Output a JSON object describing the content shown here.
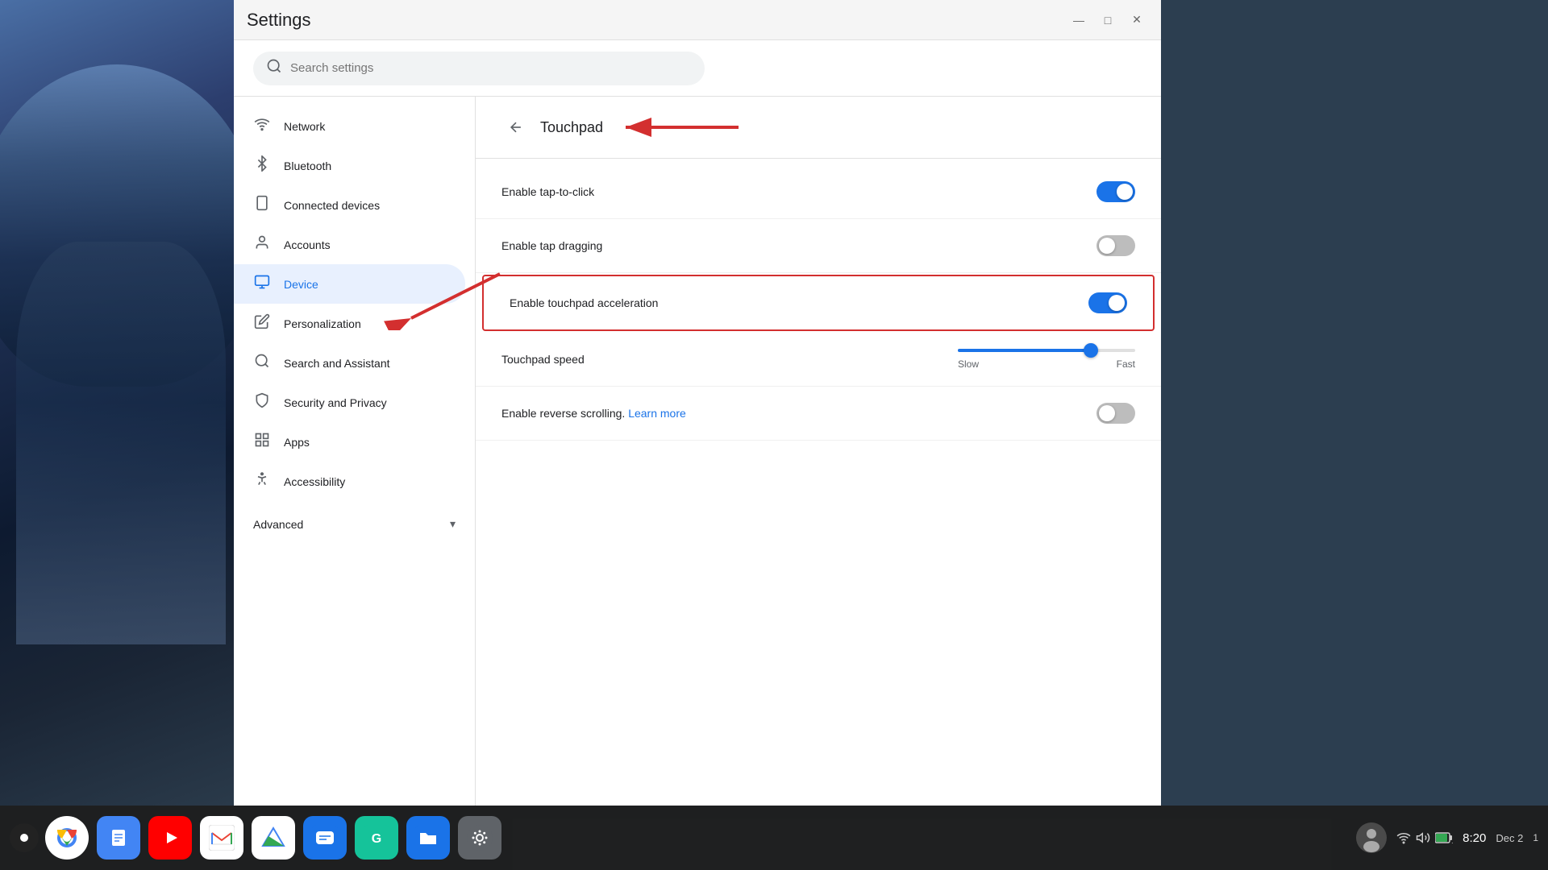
{
  "window": {
    "title": "Settings",
    "controls": {
      "minimize": "—",
      "maximize": "□",
      "close": "✕"
    }
  },
  "header": {
    "title": "Settings",
    "search_placeholder": "Search settings"
  },
  "sidebar": {
    "items": [
      {
        "id": "network",
        "label": "Network",
        "icon": "wifi"
      },
      {
        "id": "bluetooth",
        "label": "Bluetooth",
        "icon": "bluetooth"
      },
      {
        "id": "connected-devices",
        "label": "Connected devices",
        "icon": "smartphone"
      },
      {
        "id": "accounts",
        "label": "Accounts",
        "icon": "person"
      },
      {
        "id": "device",
        "label": "Device",
        "icon": "laptop",
        "active": true
      },
      {
        "id": "personalization",
        "label": "Personalization",
        "icon": "edit"
      },
      {
        "id": "search-assistant",
        "label": "Search and Assistant",
        "icon": "search"
      },
      {
        "id": "security-privacy",
        "label": "Security and Privacy",
        "icon": "shield"
      },
      {
        "id": "apps",
        "label": "Apps",
        "icon": "grid"
      },
      {
        "id": "accessibility",
        "label": "Accessibility",
        "icon": "accessibility"
      }
    ],
    "advanced": {
      "label": "Advanced",
      "icon": "chevron-down"
    }
  },
  "content": {
    "back_button": "←",
    "title": "Touchpad",
    "settings": [
      {
        "id": "tap-to-click",
        "label": "Enable tap-to-click",
        "type": "toggle",
        "value": true,
        "highlighted": false
      },
      {
        "id": "tap-dragging",
        "label": "Enable tap dragging",
        "type": "toggle",
        "value": false,
        "highlighted": false
      },
      {
        "id": "touchpad-acceleration",
        "label": "Enable touchpad acceleration",
        "type": "toggle",
        "value": true,
        "highlighted": true
      },
      {
        "id": "touchpad-speed",
        "label": "Touchpad speed",
        "type": "slider",
        "value": 75,
        "min_label": "Slow",
        "max_label": "Fast",
        "highlighted": false
      },
      {
        "id": "reverse-scrolling",
        "label": "Enable reverse scrolling.",
        "link_text": "Learn more",
        "type": "toggle",
        "value": false,
        "highlighted": false
      }
    ]
  },
  "taskbar": {
    "apps": [
      {
        "id": "chrome",
        "label": "Chrome"
      },
      {
        "id": "docs",
        "label": "Docs"
      },
      {
        "id": "youtube",
        "label": "YouTube"
      },
      {
        "id": "gmail",
        "label": "Gmail"
      },
      {
        "id": "drive",
        "label": "Drive"
      },
      {
        "id": "messages",
        "label": "Messages"
      },
      {
        "id": "grammarly",
        "label": "Grammarly"
      },
      {
        "id": "files",
        "label": "Files"
      },
      {
        "id": "settings",
        "label": "Settings"
      }
    ],
    "time": "8:20",
    "date": "Dec 2",
    "status": {
      "wifi": "wifi",
      "volume": "volume",
      "battery": "battery"
    }
  },
  "annotations": {
    "arrow1_label": "arrow pointing to Touchpad title",
    "arrow2_label": "arrow pointing to Device menu item"
  }
}
